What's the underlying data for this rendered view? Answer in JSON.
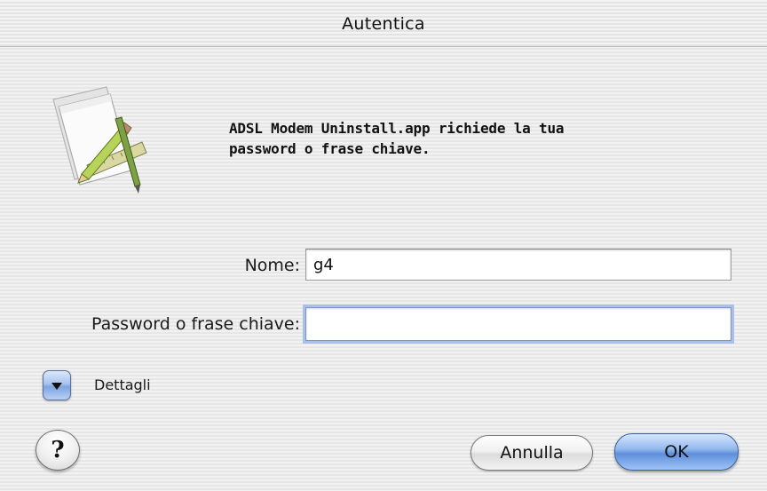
{
  "window": {
    "title": "Autentica"
  },
  "dialog": {
    "message_line1": "ADSL Modem Uninstall.app richiede la tua",
    "message_line2": "password o frase chiave.",
    "icon": "application-pencil-ruler-icon"
  },
  "form": {
    "name_label": "Nome:",
    "name_value": "g4",
    "password_label": "Password o frase chiave:",
    "password_value": ""
  },
  "details": {
    "label": "Dettagli",
    "icon": "disclosure-triangle-down-icon"
  },
  "buttons": {
    "help_label": "?",
    "cancel_label": "Annulla",
    "ok_label": "OK"
  }
}
